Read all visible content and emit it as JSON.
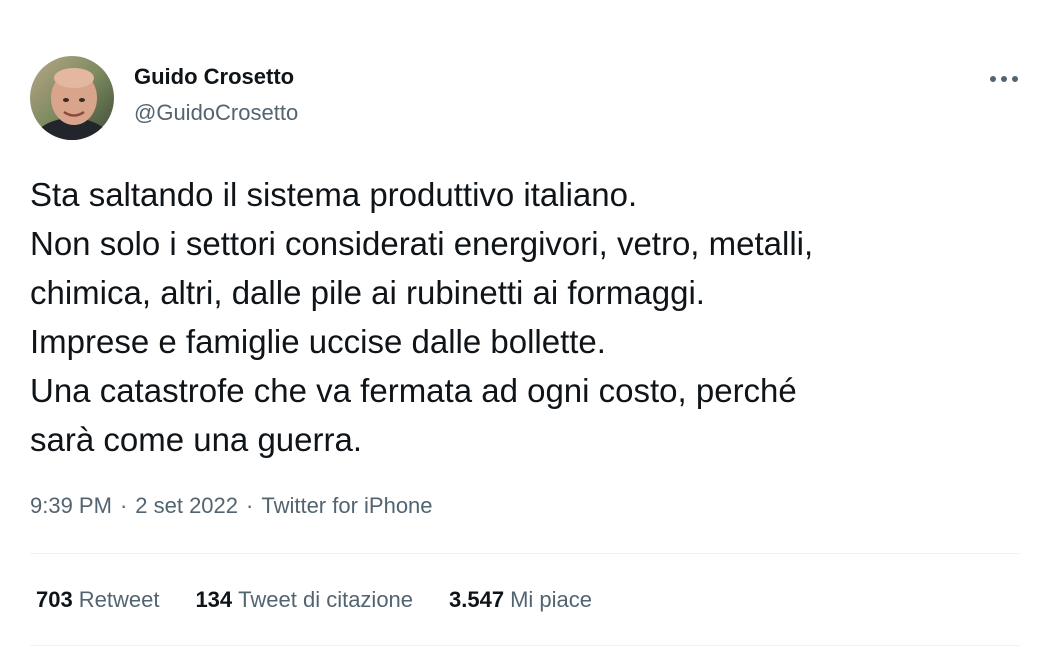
{
  "author": {
    "name": "Guido Crosetto",
    "handle": "@GuidoCrosetto"
  },
  "tweet": {
    "lines": [
      "Sta saltando il sistema produttivo italiano.",
      "Non solo i settori considerati energivori, vetro, metalli,",
      "chimica, altri, dalle pile ai rubinetti ai formaggi.",
      "Imprese e famiglie uccise dalle bollette.",
      "Una catastrofe che va fermata ad ogni costo, perché",
      "sarà come una guerra."
    ]
  },
  "meta": {
    "time": "9:39 PM",
    "date": "2 set 2022",
    "source": "Twitter for iPhone",
    "separator": "·"
  },
  "stats": {
    "retweets": {
      "count": "703",
      "label": "Retweet"
    },
    "quotes": {
      "count": "134",
      "label": "Tweet di citazione"
    },
    "likes": {
      "count": "3.547",
      "label": "Mi piace"
    }
  },
  "icons": {
    "more": "more-horizontal-icon"
  },
  "colors": {
    "text_primary": "#0f1419",
    "text_secondary": "#536471",
    "divider": "#eff3f4"
  }
}
